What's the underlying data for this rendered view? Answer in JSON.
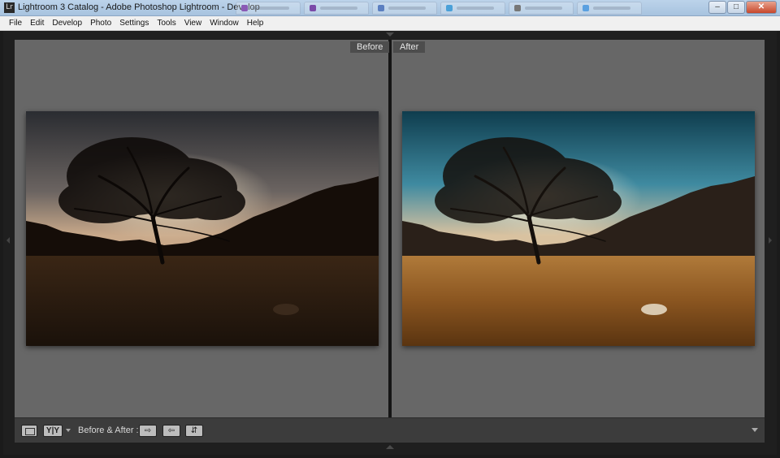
{
  "window": {
    "title": "Lightroom 3 Catalog - Adobe Photoshop Lightroom - Develop",
    "app_icon": "Lr",
    "buttons": {
      "minimize": "–",
      "maximize": "□",
      "close": "✕"
    }
  },
  "menu": [
    "File",
    "Edit",
    "Develop",
    "Photo",
    "Settings",
    "Tools",
    "View",
    "Window",
    "Help"
  ],
  "compare": {
    "before_label": "Before",
    "after_label": "After"
  },
  "toolbar": {
    "yy_label": "Y|Y",
    "mode_label": "Before & After :"
  },
  "icons": {
    "app": "lightroom-icon",
    "loupe": "loupe-view-icon",
    "before_after": "before-after-icon",
    "copy_before_to_after": "copy-before-to-after-icon",
    "copy_after_to_before": "copy-after-to-before-icon",
    "swap": "swap-icon",
    "toolbar_menu": "toolbar-menu-icon"
  },
  "colors": {
    "pane_bg": "#676767",
    "toolbar_bg": "#3c3c3c",
    "label_bg": "#4d4d4d"
  }
}
